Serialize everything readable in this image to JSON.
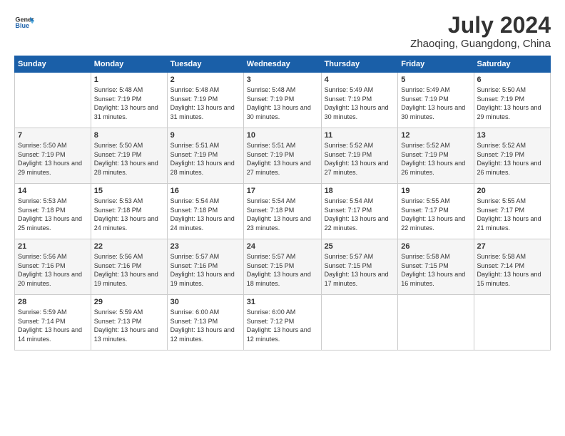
{
  "header": {
    "logo_line1": "General",
    "logo_line2": "Blue",
    "title": "July 2024",
    "subtitle": "Zhaoqing, Guangdong, China"
  },
  "columns": [
    "Sunday",
    "Monday",
    "Tuesday",
    "Wednesday",
    "Thursday",
    "Friday",
    "Saturday"
  ],
  "weeks": [
    [
      {
        "day": "",
        "sunrise": "",
        "sunset": "",
        "daylight": ""
      },
      {
        "day": "1",
        "sunrise": "Sunrise: 5:48 AM",
        "sunset": "Sunset: 7:19 PM",
        "daylight": "Daylight: 13 hours and 31 minutes."
      },
      {
        "day": "2",
        "sunrise": "Sunrise: 5:48 AM",
        "sunset": "Sunset: 7:19 PM",
        "daylight": "Daylight: 13 hours and 31 minutes."
      },
      {
        "day": "3",
        "sunrise": "Sunrise: 5:48 AM",
        "sunset": "Sunset: 7:19 PM",
        "daylight": "Daylight: 13 hours and 30 minutes."
      },
      {
        "day": "4",
        "sunrise": "Sunrise: 5:49 AM",
        "sunset": "Sunset: 7:19 PM",
        "daylight": "Daylight: 13 hours and 30 minutes."
      },
      {
        "day": "5",
        "sunrise": "Sunrise: 5:49 AM",
        "sunset": "Sunset: 7:19 PM",
        "daylight": "Daylight: 13 hours and 30 minutes."
      },
      {
        "day": "6",
        "sunrise": "Sunrise: 5:50 AM",
        "sunset": "Sunset: 7:19 PM",
        "daylight": "Daylight: 13 hours and 29 minutes."
      }
    ],
    [
      {
        "day": "7",
        "sunrise": "Sunrise: 5:50 AM",
        "sunset": "Sunset: 7:19 PM",
        "daylight": "Daylight: 13 hours and 29 minutes."
      },
      {
        "day": "8",
        "sunrise": "Sunrise: 5:50 AM",
        "sunset": "Sunset: 7:19 PM",
        "daylight": "Daylight: 13 hours and 28 minutes."
      },
      {
        "day": "9",
        "sunrise": "Sunrise: 5:51 AM",
        "sunset": "Sunset: 7:19 PM",
        "daylight": "Daylight: 13 hours and 28 minutes."
      },
      {
        "day": "10",
        "sunrise": "Sunrise: 5:51 AM",
        "sunset": "Sunset: 7:19 PM",
        "daylight": "Daylight: 13 hours and 27 minutes."
      },
      {
        "day": "11",
        "sunrise": "Sunrise: 5:52 AM",
        "sunset": "Sunset: 7:19 PM",
        "daylight": "Daylight: 13 hours and 27 minutes."
      },
      {
        "day": "12",
        "sunrise": "Sunrise: 5:52 AM",
        "sunset": "Sunset: 7:19 PM",
        "daylight": "Daylight: 13 hours and 26 minutes."
      },
      {
        "day": "13",
        "sunrise": "Sunrise: 5:52 AM",
        "sunset": "Sunset: 7:19 PM",
        "daylight": "Daylight: 13 hours and 26 minutes."
      }
    ],
    [
      {
        "day": "14",
        "sunrise": "Sunrise: 5:53 AM",
        "sunset": "Sunset: 7:18 PM",
        "daylight": "Daylight: 13 hours and 25 minutes."
      },
      {
        "day": "15",
        "sunrise": "Sunrise: 5:53 AM",
        "sunset": "Sunset: 7:18 PM",
        "daylight": "Daylight: 13 hours and 24 minutes."
      },
      {
        "day": "16",
        "sunrise": "Sunrise: 5:54 AM",
        "sunset": "Sunset: 7:18 PM",
        "daylight": "Daylight: 13 hours and 24 minutes."
      },
      {
        "day": "17",
        "sunrise": "Sunrise: 5:54 AM",
        "sunset": "Sunset: 7:18 PM",
        "daylight": "Daylight: 13 hours and 23 minutes."
      },
      {
        "day": "18",
        "sunrise": "Sunrise: 5:54 AM",
        "sunset": "Sunset: 7:17 PM",
        "daylight": "Daylight: 13 hours and 22 minutes."
      },
      {
        "day": "19",
        "sunrise": "Sunrise: 5:55 AM",
        "sunset": "Sunset: 7:17 PM",
        "daylight": "Daylight: 13 hours and 22 minutes."
      },
      {
        "day": "20",
        "sunrise": "Sunrise: 5:55 AM",
        "sunset": "Sunset: 7:17 PM",
        "daylight": "Daylight: 13 hours and 21 minutes."
      }
    ],
    [
      {
        "day": "21",
        "sunrise": "Sunrise: 5:56 AM",
        "sunset": "Sunset: 7:16 PM",
        "daylight": "Daylight: 13 hours and 20 minutes."
      },
      {
        "day": "22",
        "sunrise": "Sunrise: 5:56 AM",
        "sunset": "Sunset: 7:16 PM",
        "daylight": "Daylight: 13 hours and 19 minutes."
      },
      {
        "day": "23",
        "sunrise": "Sunrise: 5:57 AM",
        "sunset": "Sunset: 7:16 PM",
        "daylight": "Daylight: 13 hours and 19 minutes."
      },
      {
        "day": "24",
        "sunrise": "Sunrise: 5:57 AM",
        "sunset": "Sunset: 7:15 PM",
        "daylight": "Daylight: 13 hours and 18 minutes."
      },
      {
        "day": "25",
        "sunrise": "Sunrise: 5:57 AM",
        "sunset": "Sunset: 7:15 PM",
        "daylight": "Daylight: 13 hours and 17 minutes."
      },
      {
        "day": "26",
        "sunrise": "Sunrise: 5:58 AM",
        "sunset": "Sunset: 7:15 PM",
        "daylight": "Daylight: 13 hours and 16 minutes."
      },
      {
        "day": "27",
        "sunrise": "Sunrise: 5:58 AM",
        "sunset": "Sunset: 7:14 PM",
        "daylight": "Daylight: 13 hours and 15 minutes."
      }
    ],
    [
      {
        "day": "28",
        "sunrise": "Sunrise: 5:59 AM",
        "sunset": "Sunset: 7:14 PM",
        "daylight": "Daylight: 13 hours and 14 minutes."
      },
      {
        "day": "29",
        "sunrise": "Sunrise: 5:59 AM",
        "sunset": "Sunset: 7:13 PM",
        "daylight": "Daylight: 13 hours and 13 minutes."
      },
      {
        "day": "30",
        "sunrise": "Sunrise: 6:00 AM",
        "sunset": "Sunset: 7:13 PM",
        "daylight": "Daylight: 13 hours and 12 minutes."
      },
      {
        "day": "31",
        "sunrise": "Sunrise: 6:00 AM",
        "sunset": "Sunset: 7:12 PM",
        "daylight": "Daylight: 13 hours and 12 minutes."
      },
      {
        "day": "",
        "sunrise": "",
        "sunset": "",
        "daylight": ""
      },
      {
        "day": "",
        "sunrise": "",
        "sunset": "",
        "daylight": ""
      },
      {
        "day": "",
        "sunrise": "",
        "sunset": "",
        "daylight": ""
      }
    ]
  ]
}
